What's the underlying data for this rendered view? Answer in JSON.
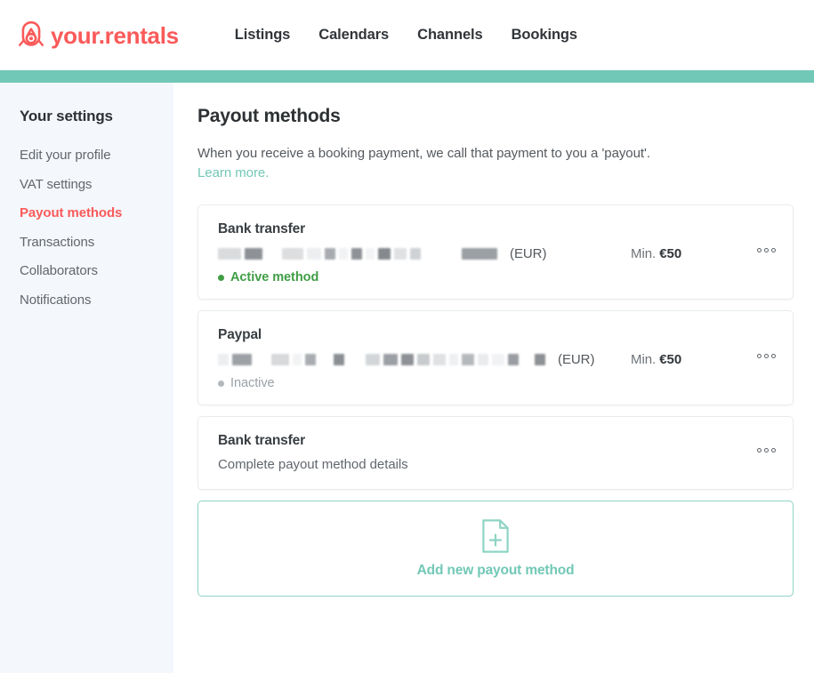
{
  "brand": {
    "name": "your.rentals",
    "logo_icon": "rental-key-logo-icon",
    "color": "#fa5a5a"
  },
  "topnav": {
    "items": [
      {
        "label": "Listings"
      },
      {
        "label": "Calendars"
      },
      {
        "label": "Channels"
      },
      {
        "label": "Bookings"
      }
    ],
    "accent_rule_color": "#72c8b6"
  },
  "sidebar": {
    "title": "Your settings",
    "items": [
      {
        "label": "Edit your profile",
        "active": false
      },
      {
        "label": "VAT settings",
        "active": false
      },
      {
        "label": "Payout methods",
        "active": true
      },
      {
        "label": "Transactions",
        "active": false
      },
      {
        "label": "Collaborators",
        "active": false
      },
      {
        "label": "Notifications",
        "active": false
      }
    ]
  },
  "main": {
    "title": "Payout methods",
    "intro_text": "When you receive a booking payment, we call that payment to you a 'payout'.",
    "intro_link": "Learn more.",
    "cards": [
      {
        "title": "Bank transfer",
        "account_redacted": true,
        "currency": "(EUR)",
        "min_label": "Min.",
        "min_value": "€50",
        "status_text": "Active method",
        "status_type": "active",
        "menu_icon": "kebab-menu-icon"
      },
      {
        "title": "Paypal",
        "account_redacted": true,
        "currency": "(EUR)",
        "min_label": "Min.",
        "min_value": "€50",
        "status_text": "Inactive",
        "status_type": "inactive",
        "menu_icon": "kebab-menu-icon"
      },
      {
        "title": "Bank transfer",
        "subtitle": "Complete payout method details",
        "menu_icon": "kebab-menu-icon"
      }
    ],
    "add_new": {
      "label": "Add new payout method",
      "icon": "document-plus-icon",
      "color": "#72c8b6"
    }
  }
}
